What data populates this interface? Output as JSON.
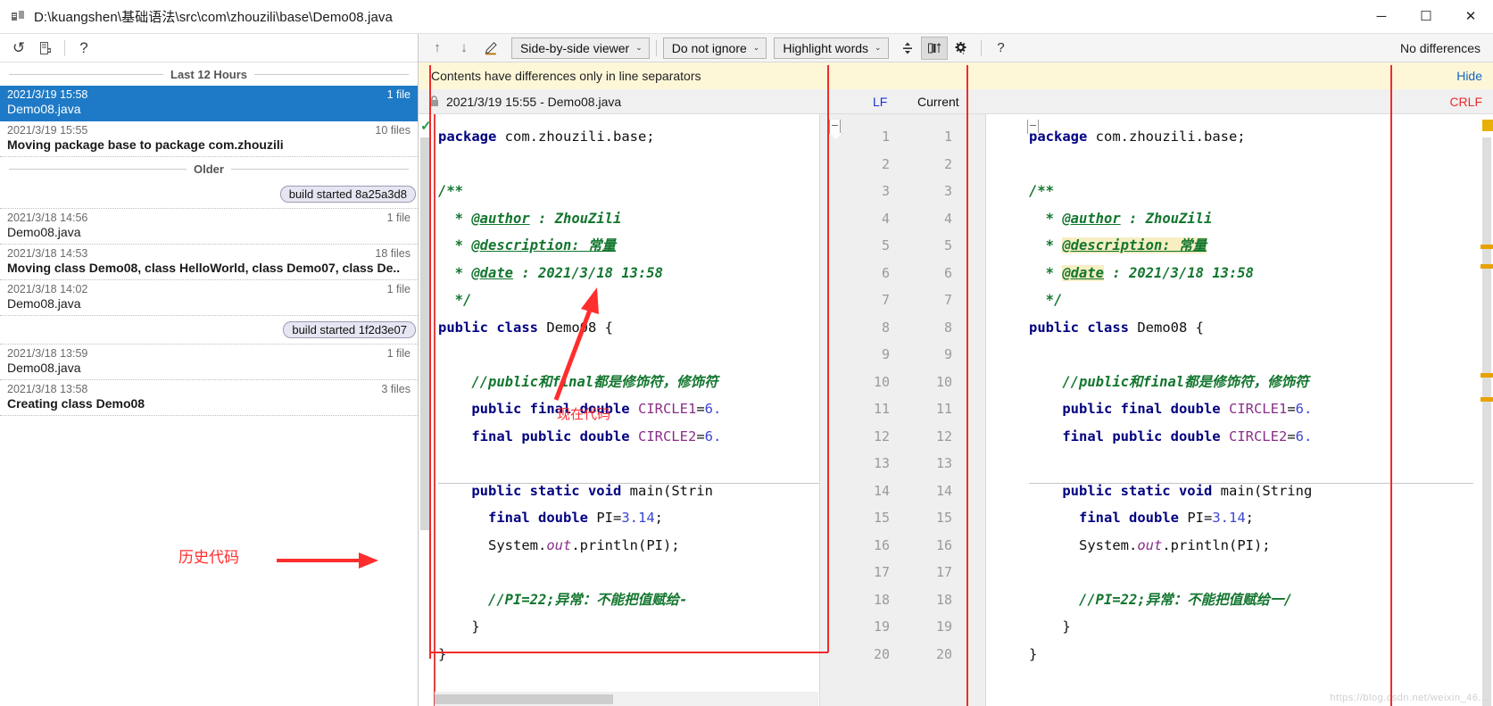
{
  "window": {
    "title": "D:\\kuangshen\\基础语法\\src\\com\\zhouzili\\base\\Demo08.java",
    "app_icon": "diff-app-icon",
    "minimize": "─",
    "maximize": "☐",
    "close": "✕"
  },
  "left_toolbar": {
    "undo": "↺",
    "save": "save-icon",
    "help": "?"
  },
  "history": {
    "groups": [
      {
        "label": "Last 12 Hours",
        "entries": [
          {
            "kind": "revision",
            "time": "2021/3/19 15:58",
            "files": "1 file",
            "label": "Demo08.java",
            "bold": false,
            "selected": true
          },
          {
            "kind": "revision",
            "time": "2021/3/19 15:55",
            "files": "10 files",
            "label": "Moving package base to package com.zhouzili",
            "bold": true,
            "selected": false
          }
        ]
      },
      {
        "label": "Older",
        "entries": [
          {
            "kind": "build",
            "label": "build started 8a25a3d8"
          },
          {
            "kind": "revision",
            "time": "2021/3/18 14:56",
            "files": "1 file",
            "label": "Demo08.java",
            "bold": false,
            "selected": false
          },
          {
            "kind": "revision",
            "time": "2021/3/18 14:53",
            "files": "18 files",
            "label": "Moving class Demo08, class HelloWorld, class Demo07, class De..",
            "bold": true,
            "selected": false
          },
          {
            "kind": "revision",
            "time": "2021/3/18 14:02",
            "files": "1 file",
            "label": "Demo08.java",
            "bold": false,
            "selected": false
          },
          {
            "kind": "build",
            "label": "build started 1f2d3e07"
          },
          {
            "kind": "revision",
            "time": "2021/3/18 13:59",
            "files": "1 file",
            "label": "Demo08.java",
            "bold": false,
            "selected": false
          },
          {
            "kind": "revision",
            "time": "2021/3/18 13:58",
            "files": "3 files",
            "label": "Creating class Demo08",
            "bold": true,
            "selected": false
          }
        ]
      }
    ]
  },
  "annotations": {
    "left": "历史代码",
    "right": "现在代码"
  },
  "diff_toolbar": {
    "prev_diff": "↑",
    "next_diff": "↓",
    "edit": "pencil-icon",
    "viewer_mode": "Side-by-side viewer",
    "ignore_mode": "Do not ignore",
    "highlight_mode": "Highlight words",
    "collapse": "collapse-unchanged-icon",
    "columns": "column-diff-icon",
    "settings": "gear-icon",
    "help": "?",
    "status": "No differences",
    "carat": "⌄"
  },
  "notice": {
    "message": "Contents have differences only in line separators",
    "hide": "Hide"
  },
  "file_header": {
    "lock": "lock-icon",
    "title": "2021/3/19 15:55 - Demo08.java",
    "left_sep": "LF",
    "right_sep_label": "Current",
    "right_sep": "CRLF"
  },
  "watermark": "https://blog.csdn.net/weixin_46...",
  "code": {
    "left_lines": [
      {
        "n": 1,
        "html": "<span class='kw'>package</span> <span class='gray'>com.zhouzili.base;</span>"
      },
      {
        "n": 2,
        "html": ""
      },
      {
        "n": 3,
        "html": "<span class='cmt'>/**</span>"
      },
      {
        "n": 4,
        "html": "<span class='cmt'>  * <u>@author</u> : ZhouZili</span>"
      },
      {
        "n": 5,
        "html": "<span class='cmt'>  * <u>@description: 常量</u></span>"
      },
      {
        "n": 6,
        "html": "<span class='cmt'>  * <u>@date</u> : 2021/3/18 13:58</span>"
      },
      {
        "n": 7,
        "html": "<span class='cmt'>  */</span>"
      },
      {
        "n": 8,
        "html": "<span class='kw'>public class</span> <span class='gray'>Demo08 {</span>"
      },
      {
        "n": 9,
        "html": ""
      },
      {
        "n": 10,
        "html": "    <span class='cmt'>//public和final都是修饰符，修饰符</span>"
      },
      {
        "n": 11,
        "html": "    <span class='kw'>public final double</span> <span class='fld'>CIRCLE1</span><span class='gray'>=</span><span class='num'>6.</span>"
      },
      {
        "n": 12,
        "html": "    <span class='kw'>final public double</span> <span class='fld'>CIRCLE2</span><span class='gray'>=</span><span class='num'>6.</span>"
      },
      {
        "n": 13,
        "html": ""
      },
      {
        "n": 14,
        "html": "    <span class='kw'>public static void</span> <span class='gray'>main(Strin</span>"
      },
      {
        "n": 15,
        "html": "      <span class='kw'>final double</span> <span class='gray'>PI=</span><span class='num'>3.14</span><span class='gray'>;</span>"
      },
      {
        "n": 16,
        "html": "      <span class='gray'>System.</span><span class='fld'><i>out</i></span><span class='gray'>.println(PI);</span>"
      },
      {
        "n": 17,
        "html": ""
      },
      {
        "n": 18,
        "html": "      <span class='cmt'>//PI=22;异常：不能把值赋给-</span>"
      },
      {
        "n": 19,
        "html": "    <span class='gray'>}</span>"
      },
      {
        "n": 20,
        "html": "<span class='gray'>}</span>"
      }
    ],
    "right_lines": [
      {
        "n": 1,
        "html": "<span class='kw'>package</span> <span class='gray'>com.zhouzili.base;</span>"
      },
      {
        "n": 2,
        "html": ""
      },
      {
        "n": 3,
        "html": "<span class='cmt'>/**</span>"
      },
      {
        "n": 4,
        "html": "<span class='cmt'>  * <u>@author</u> : ZhouZili</span>"
      },
      {
        "n": 5,
        "html": "<span class='cmt'>  * <span class='hl'><u>@description: 常量</u></span></span>"
      },
      {
        "n": 6,
        "html": "<span class='cmt'>  * <span class='hl'><u>@date</u></span> : 2021/3/18 13:58</span>"
      },
      {
        "n": 7,
        "html": "<span class='cmt'>  */</span>"
      },
      {
        "n": 8,
        "html": "<span class='kw'>public class</span> <span class='gray'>Demo08 {</span>"
      },
      {
        "n": 9,
        "html": ""
      },
      {
        "n": 10,
        "html": "    <span class='cmt'>//public和final都是修饰符，修饰符</span>"
      },
      {
        "n": 11,
        "html": "    <span class='kw'>public final double</span> <span class='fld'>CIRCLE1</span><span class='gray'>=</span><span class='num'>6.</span>"
      },
      {
        "n": 12,
        "html": "    <span class='kw'>final public double</span> <span class='fld'>CIRCLE2</span><span class='gray'>=</span><span class='num'>6.</span>"
      },
      {
        "n": 13,
        "html": ""
      },
      {
        "n": 14,
        "html": "    <span class='kw'>public static void</span> <span class='gray'>main(String</span>"
      },
      {
        "n": 15,
        "html": "      <span class='kw'>final double</span> <span class='gray'>PI=</span><span class='num'>3.14</span><span class='gray'>;</span>"
      },
      {
        "n": 16,
        "html": "      <span class='gray'>System.</span><span class='fld'><i>out</i></span><span class='gray'>.println(PI);</span>"
      },
      {
        "n": 17,
        "html": ""
      },
      {
        "n": 18,
        "html": "      <span class='cmt'>//PI=22;异常：不能把值赋给一/</span>"
      },
      {
        "n": 19,
        "html": "    <span class='gray'>}</span>"
      },
      {
        "n": 20,
        "html": "<span class='gray'>}</span>"
      }
    ],
    "line_numbers": [
      1,
      2,
      3,
      4,
      5,
      6,
      7,
      8,
      9,
      10,
      11,
      12,
      13,
      14,
      15,
      16,
      17,
      18,
      19,
      20
    ]
  },
  "colors": {
    "selection": "#1e7ac6",
    "notice_bg": "#fdf7d8",
    "annotation": "#ff2d2d",
    "keyword": "#000080",
    "comment": "#13762f",
    "number": "#3b46d2",
    "marker": "#e8a200"
  }
}
